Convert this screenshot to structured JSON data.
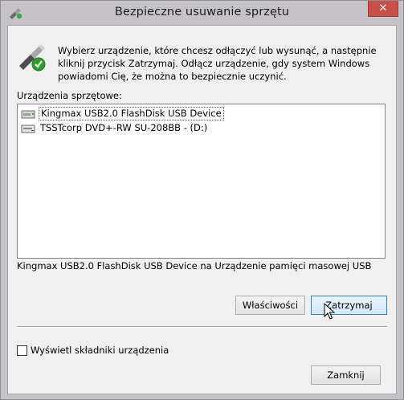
{
  "window": {
    "title": "Bezpieczne usuwanie sprzętu",
    "close_glyph": "✕"
  },
  "dialog": {
    "instructions": "Wybierz urządzenie, które chcesz odłączyć lub wysunąć, a następnie kliknij przycisk Zatrzymaj. Odłącz urządzenie, gdy system Windows powiadomi Cię, że można to bezpiecznie uczynić.",
    "list_label": "Urządzenia sprzętowe:",
    "devices": [
      {
        "label": "Kingmax USB2.0 FlashDisk USB Device",
        "icon": "usb-drive-icon",
        "selected": true
      },
      {
        "label": "TSSTcorp DVD+-RW SU-208BB - (D:)",
        "icon": "dvd-drive-icon",
        "selected": false
      }
    ],
    "device_description": "Kingmax USB2.0 FlashDisk USB Device na Urządzenie pamięci masowej USB",
    "properties_button": "Właściwości",
    "stop_button": "Zatrzymaj",
    "show_components_label": "Wyświetl składniki urządzenia",
    "show_components_checked": false,
    "close_button": "Zamknij"
  },
  "colors": {
    "frame": "#c5c3c7",
    "close_button": "#c7504a",
    "client_background": "#f0f0f0",
    "primary_button_border": "#3c7fb1"
  }
}
